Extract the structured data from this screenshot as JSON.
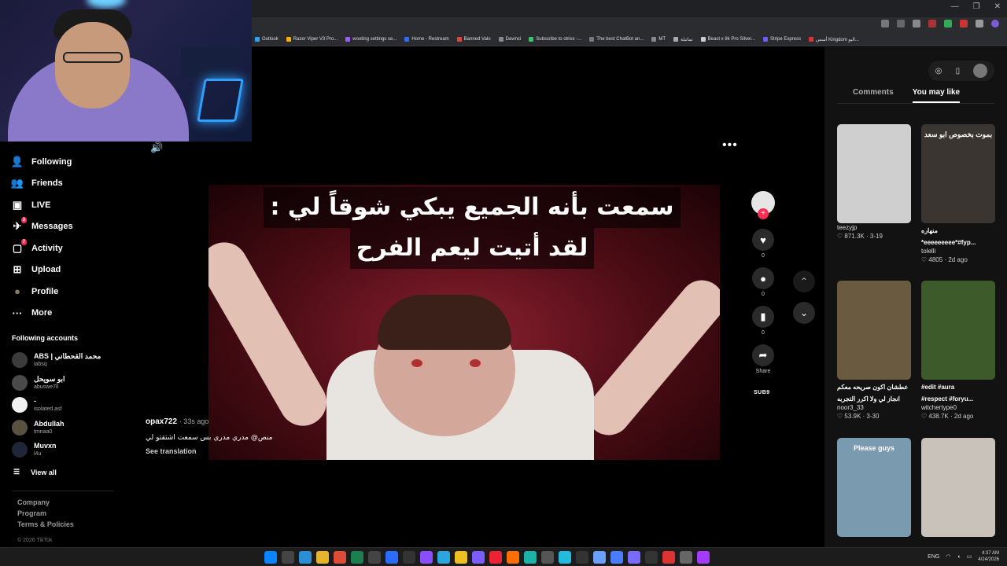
{
  "browser": {
    "bookmarks": [
      "Outlook",
      "Razer Viper V3 Pro...",
      "wooting settings se...",
      "Home - Restream",
      "Banned Valo",
      "Davinci",
      "Subscribe to otrixx -...",
      "The best ChatBot an...",
      "MT",
      "تماثيلة",
      "Beast x 8k Pro Silver...",
      "Stripe Express",
      "أسس Kingdom اليو..."
    ],
    "window_buttons": [
      "—",
      "❐",
      "✕"
    ]
  },
  "nav": {
    "items": [
      {
        "label": "Following",
        "icon": "following-icon",
        "glyph": "👤",
        "badge": ""
      },
      {
        "label": "Friends",
        "icon": "friends-icon",
        "glyph": "👥",
        "badge": ""
      },
      {
        "label": "LIVE",
        "icon": "live-icon",
        "glyph": "▣",
        "badge": ""
      },
      {
        "label": "Messages",
        "icon": "messages-icon",
        "glyph": "✈",
        "badge": "3"
      },
      {
        "label": "Activity",
        "icon": "activity-icon",
        "glyph": "▢",
        "badge": "7"
      },
      {
        "label": "Upload",
        "icon": "upload-icon",
        "glyph": "⊞",
        "badge": ""
      },
      {
        "label": "Profile",
        "icon": "profile-avatar",
        "glyph": "●",
        "badge": ""
      },
      {
        "label": "More",
        "icon": "more-icon",
        "glyph": "···",
        "badge": ""
      }
    ],
    "following_title": "Following accounts",
    "accounts": [
      {
        "name": "ABS | محمد القحطاني",
        "handle": "iabsq",
        "color": "#3b3b3b"
      },
      {
        "name": "ابو سويحل",
        "handle": "abuswe7ll",
        "color": "#4a4a4a"
      },
      {
        "name": "-",
        "handle": "isolated.asf",
        "color": "#f0f0f0"
      },
      {
        "name": "Abdullah",
        "handle": "tmnaa0",
        "color": "#5a5040"
      },
      {
        "name": "Muvxn",
        "handle": "l4u",
        "color": "#20263a"
      }
    ],
    "view_all": "View all",
    "footer": [
      "Company",
      "Program",
      "Terms & Policies"
    ],
    "copyright": "© 2026 TikTok"
  },
  "video": {
    "caption_line1": "سمعت بأنه الجميع يبكي شوقاً لي :",
    "caption_line2": "لقد أتيت ليعم الفرح",
    "author": "opax722",
    "time": "· 33s ago",
    "description": "منص@ مدري مدري بس سمعت  اشتقتو لي",
    "see_translation": "See translation",
    "more": "•••",
    "speaker": "🔊"
  },
  "actions": {
    "likes": "0",
    "comments": "0",
    "saves": "0",
    "share": "Share",
    "watermark": "SUB9"
  },
  "right_panel": {
    "tabs": [
      "Comments",
      "You may like"
    ],
    "active_tab": "You may like",
    "cards": [
      {
        "title": "",
        "handle": "teezyjp",
        "likes": "871.3K",
        "date": "3-19",
        "thumb_label": "",
        "bg": "#cfcfcf"
      },
      {
        "title": "منهاره",
        "title2": "*eeeeeeeee*#fyp...",
        "handle": "tolelli",
        "likes": "4805",
        "date": "2d ago",
        "thumb_label": "بموت بخصوص ابو سعد",
        "bg": "#3a3530"
      },
      {
        "title": "عطشان اكون صريحه معكم",
        "title2": "انجاز لي ولا اكرر التجربه",
        "handle": "noor3_33",
        "likes": "53.9K",
        "date": "3-30",
        "thumb_label": "",
        "bg": "#6a5a40"
      },
      {
        "title": "#edit #aura",
        "title2": "#respect #foryu...",
        "handle": "witchertype0",
        "likes": "438.7K",
        "date": "2d ago",
        "thumb_label": "",
        "bg": "#3c5a2a"
      },
      {
        "title": "",
        "handle": "",
        "likes": "",
        "date": "",
        "thumb_label": "Please guys",
        "bg": "#7a9ab0"
      },
      {
        "title": "",
        "handle": "",
        "likes": "",
        "date": "",
        "thumb_label": "",
        "bg": "#c8c2ba"
      }
    ]
  },
  "taskbar": {
    "lang": "ENG",
    "time": "4:37 AM",
    "date": "4/24/2026"
  }
}
